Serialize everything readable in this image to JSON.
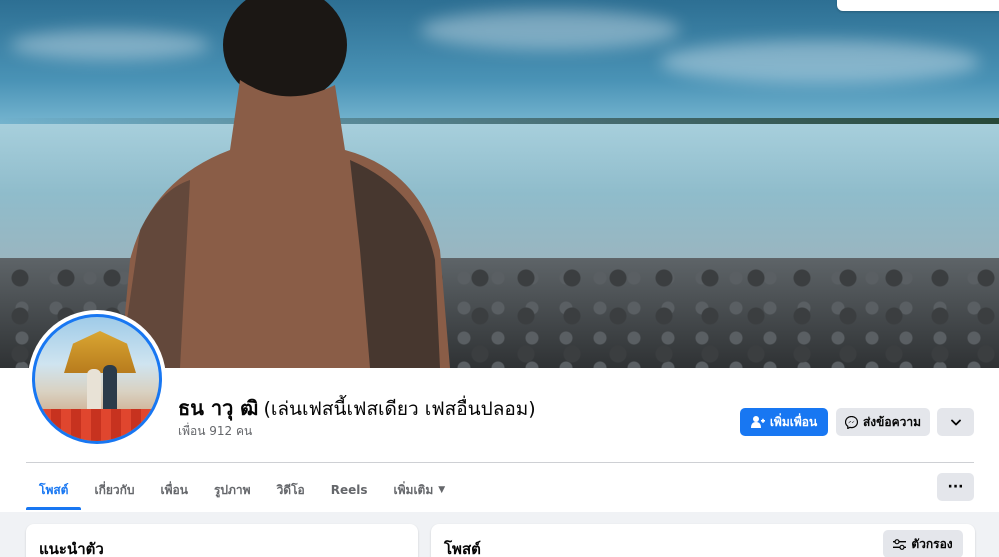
{
  "profile": {
    "name": "ธน าวุ ฒิ",
    "nickname": "(เล่นเฟสนี้เฟสเดียว เฟสอื่นปลอม)",
    "friends_count": "เพื่อน 912 คน"
  },
  "actions": {
    "add_friend": "เพิ่มเพื่อน",
    "message": "ส่งข้อความ"
  },
  "tabs": [
    {
      "label": "โพสต์",
      "active": true
    },
    {
      "label": "เกี่ยวกับ",
      "active": false
    },
    {
      "label": "เพื่อน",
      "active": false
    },
    {
      "label": "รูปภาพ",
      "active": false
    },
    {
      "label": "วิดีโอ",
      "active": false
    },
    {
      "label": "Reels",
      "active": false
    },
    {
      "label": "เพิ่มเติม",
      "active": false
    }
  ],
  "intro": {
    "title": "แนะนำตัว"
  },
  "posts": {
    "title": "โพสต์",
    "filter_label": "ตัวกรอง"
  },
  "colors": {
    "accent": "#1877f2",
    "button_gray": "#e4e6eb",
    "text_secondary": "#65676b"
  },
  "icons": [
    "add-friend-icon",
    "messenger-icon",
    "chevron-down-icon",
    "more-dots-icon",
    "filter-icon"
  ]
}
